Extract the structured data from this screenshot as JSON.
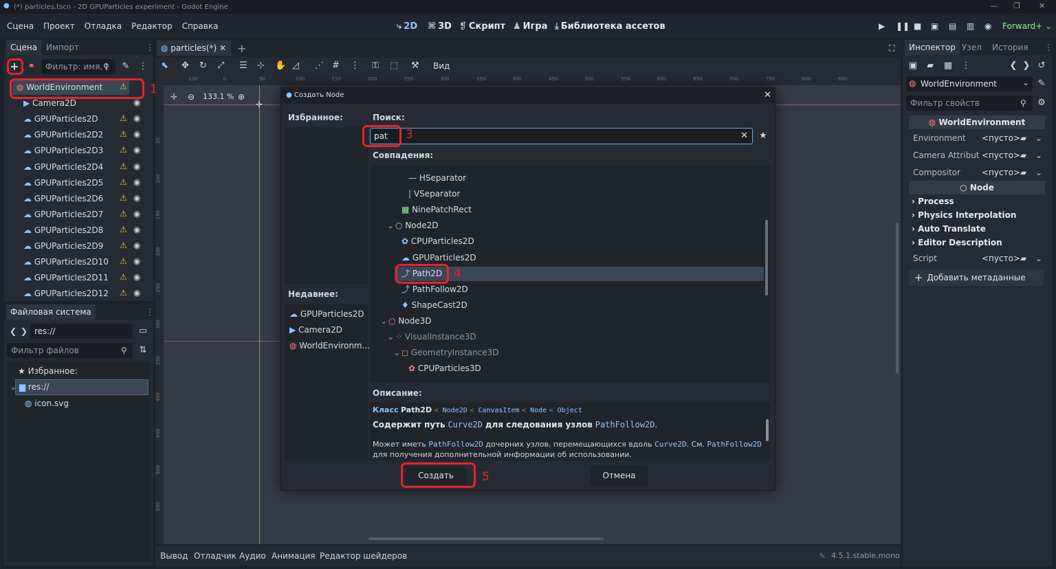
{
  "window": {
    "title": "(*) particles.tscn - 2D GPUParticles experiment - Godot Engine"
  },
  "menu": [
    "Сцена",
    "Проект",
    "Отладка",
    "Редактор",
    "Справка"
  ],
  "workspaces": {
    "w2d": "2D",
    "w3d": "3D",
    "script": "Скрипт",
    "game": "Игра",
    "assetlib": "Библиотека ассетов"
  },
  "renderer": "Forward+",
  "scene_dock": {
    "tabs": [
      "Сцена",
      "Импорт"
    ],
    "filter_placeholder": "Фильтр: имя, t",
    "nodes": [
      "WorldEnvironment",
      "Camera2D",
      "GPUParticles2D",
      "GPUParticles2D2",
      "GPUParticles2D3",
      "GPUParticles2D4",
      "GPUParticles2D5",
      "GPUParticles2D6",
      "GPUParticles2D7",
      "GPUParticles2D8",
      "GPUParticles2D9",
      "GPUParticles2D10",
      "GPUParticles2D11",
      "GPUParticles2D12"
    ]
  },
  "filesystem": {
    "title": "Файловая система",
    "path": "res://",
    "filter_placeholder": "Фильтр файлов",
    "favorites": "Избранное:",
    "root": "res://",
    "file": "icon.svg"
  },
  "editor": {
    "tab": "particles(*)",
    "view": "Вид",
    "zoom": "133.1 %",
    "ruler": [
      "-100",
      "0",
      "50",
      "100",
      "150",
      "200",
      "250",
      "300",
      "350",
      "400",
      "450",
      "500",
      "550",
      "600",
      "650",
      "700",
      "750",
      "800",
      "850"
    ],
    "vruler": [
      "50",
      "100",
      "150",
      "200",
      "250",
      "300",
      "350",
      "400",
      "450",
      "500",
      "550"
    ]
  },
  "dialog": {
    "title": "Создать Node",
    "favorites": "Избранное:",
    "recent": "Недавнее:",
    "recent_items": [
      "GPUParticles2D",
      "Camera2D",
      "WorldEnvironm..."
    ],
    "search_label": "Поиск:",
    "search_value": "pat",
    "matches_label": "Совпадения:",
    "tree": [
      {
        "label": "HSeparator",
        "icon": "—"
      },
      {
        "label": "VSeparator",
        "icon": "|"
      },
      {
        "label": "NinePatchRect",
        "icon": "▦"
      },
      {
        "label": "Node2D",
        "icon": "○"
      },
      {
        "label": "CPUParticles2D",
        "icon": "✿"
      },
      {
        "label": "GPUParticles2D",
        "icon": "☁"
      },
      {
        "label": "Path2D",
        "icon": "⤴"
      },
      {
        "label": "PathFollow2D",
        "icon": "⤴"
      },
      {
        "label": "ShapeCast2D",
        "icon": "♦"
      },
      {
        "label": "Node3D",
        "icon": "○"
      },
      {
        "label": "VisualInstance3D",
        "icon": "⁘"
      },
      {
        "label": "GeometryInstance3D",
        "icon": "◻"
      },
      {
        "label": "CPUParticles3D",
        "icon": "✿"
      }
    ],
    "description_label": "Описание:",
    "class_kw": "Класс",
    "class_name": "Path2D",
    "inherits": [
      "Node2D",
      "CanvasItem",
      "Node",
      "Object"
    ],
    "desc_bold_1": "Содержит путь",
    "desc_code_1": "Curve2D",
    "desc_bold_2": "для следования узлов",
    "desc_code_2": "PathFollow2D",
    "desc_p2_a": "Может иметь",
    "desc_p2_code1": "PathFollow2D",
    "desc_p2_b": "дочерних узлов, перемещающихся вдоль",
    "desc_p2_code2": "Curve2D",
    "desc_p2_c": ". См.",
    "desc_p2_code3": "PathFollow2D",
    "desc_p3": "для получения дополнительной информации об использовании.",
    "create": "Создать",
    "cancel": "Отмена"
  },
  "annotations": [
    "1",
    "3",
    "4",
    "5"
  ],
  "inspector": {
    "tabs": [
      "Инспектор",
      "Узел",
      "История"
    ],
    "object": "WorldEnvironment",
    "filter_placeholder": "Фильтр свойств",
    "section1": "WorldEnvironment",
    "props": [
      {
        "name": "Environment",
        "value": "<пусто>"
      },
      {
        "name": "Camera Attribut",
        "value": "<пусто>"
      },
      {
        "name": "Compositor",
        "value": "<пусто>"
      }
    ],
    "section2": "Node",
    "groups": [
      "Process",
      "Physics Interpolation",
      "Auto Translate",
      "Editor Description"
    ],
    "script_name": "Script",
    "script_value": "<пусто>",
    "add_meta": "Добавить метаданные"
  },
  "bottom": {
    "items": [
      "Вывод",
      "Отладчик",
      "Аудио",
      "Анимация",
      "Редактор шейдеров"
    ],
    "version": "4.5.1.stable.mono"
  }
}
